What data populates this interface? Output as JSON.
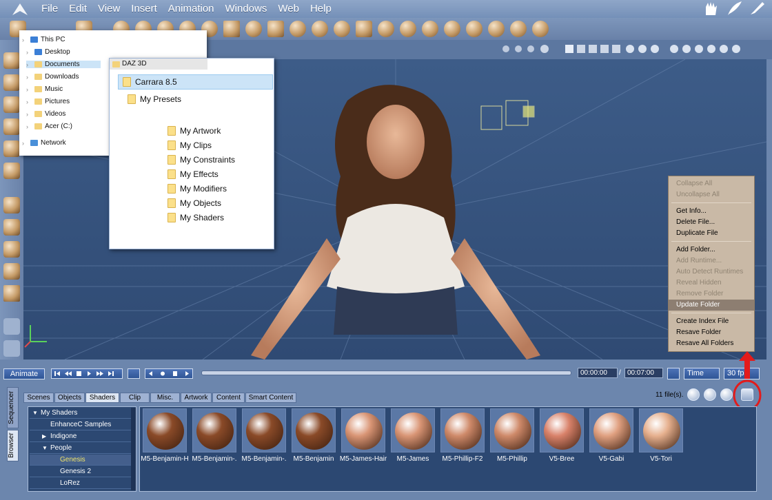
{
  "menubar": {
    "items": [
      "File",
      "Edit",
      "View",
      "Insert",
      "Animation",
      "Windows",
      "Web",
      "Help"
    ]
  },
  "explorer_tree": {
    "items": [
      {
        "label": "This PC",
        "icon": "pc-icon"
      },
      {
        "label": "Desktop",
        "icon": "desktop-folder-icon"
      },
      {
        "label": "Documents",
        "icon": "documents-folder-icon",
        "selected": true
      },
      {
        "label": "Downloads",
        "icon": "download-icon"
      },
      {
        "label": "Music",
        "icon": "music-icon"
      },
      {
        "label": "Pictures",
        "icon": "pictures-icon"
      },
      {
        "label": "Videos",
        "icon": "videos-icon"
      },
      {
        "label": "Acer (C:)",
        "icon": "drive-icon"
      },
      {
        "label": "Network",
        "icon": "network-icon"
      }
    ]
  },
  "folder_popup": {
    "header": "DAZ 3D",
    "root": "Carrara 8.5",
    "presets": "My Presets",
    "subfolders": [
      "My Artwork",
      "My Clips",
      "My Constraints",
      "My Effects",
      "My Modifiers",
      "My Objects",
      "My Shaders"
    ]
  },
  "context_menu": {
    "groups": [
      [
        {
          "label": "Collapse All",
          "disabled": true
        },
        {
          "label": "Uncollapse All",
          "disabled": true
        }
      ],
      [
        {
          "label": "Get Info...",
          "disabled": false
        },
        {
          "label": "Delete File...",
          "disabled": false
        },
        {
          "label": "Duplicate File",
          "disabled": false
        }
      ],
      [
        {
          "label": "Add Folder...",
          "disabled": false
        },
        {
          "label": "Add Runtime...",
          "disabled": true
        },
        {
          "label": "Auto Detect Runtimes",
          "disabled": true
        },
        {
          "label": "Reveal Hidden",
          "disabled": true
        },
        {
          "label": "Remove Folder",
          "disabled": true
        },
        {
          "label": "Update Folder",
          "disabled": false,
          "highlighted": true
        }
      ],
      [
        {
          "label": "Create Index File",
          "disabled": false
        },
        {
          "label": "Resave Folder",
          "disabled": false
        },
        {
          "label": "Resave All Folders",
          "disabled": false
        }
      ]
    ]
  },
  "timeline": {
    "animate_label": "Animate",
    "current_time": "00:00:00",
    "separator": "/",
    "end_time": "00:07:00",
    "time_mode": "Time",
    "fps": "30 fps"
  },
  "browser": {
    "side_tabs": [
      "Sequencer",
      "Browser"
    ],
    "tabs": [
      "Scenes",
      "Objects",
      "Shaders",
      "Clip",
      "Misc.",
      "Artwork",
      "Content",
      "Smart Content"
    ],
    "active_tab": "Shaders",
    "file_count": "11 file(s).",
    "tree": [
      {
        "label": "My Shaders",
        "indent": 0,
        "expander": "▼"
      },
      {
        "label": "EnhanceC Samples",
        "indent": 1,
        "expander": ""
      },
      {
        "label": "Indigone",
        "indent": 1,
        "expander": "▶"
      },
      {
        "label": "People",
        "indent": 1,
        "expander": "▼"
      },
      {
        "label": "Genesis",
        "indent": 2,
        "expander": "",
        "selected": true
      },
      {
        "label": "Genesis 2",
        "indent": 2,
        "expander": ""
      },
      {
        "label": "LoRez",
        "indent": 2,
        "expander": ""
      }
    ],
    "thumbnails": [
      {
        "label": "M5-Benjamin-H",
        "color": "#8a4a28"
      },
      {
        "label": "M5-Benjamin-.",
        "color": "#8a4a28"
      },
      {
        "label": "M5-Benjamin-.",
        "color": "#8a4a28"
      },
      {
        "label": "M5-Benjamin",
        "color": "#8a4a28"
      },
      {
        "label": "M5-James-Hair",
        "color": "#d99575"
      },
      {
        "label": "M5-James",
        "color": "#d99575"
      },
      {
        "label": "M5-Phillip-F2",
        "color": "#cf8a6a"
      },
      {
        "label": "M5-Phillip",
        "color": "#cf8a6a"
      },
      {
        "label": "V5-Bree",
        "color": "#d9826a"
      },
      {
        "label": "V5-Gabi",
        "color": "#e0a080"
      },
      {
        "label": "V5-Tori",
        "color": "#e6b08e"
      }
    ]
  }
}
